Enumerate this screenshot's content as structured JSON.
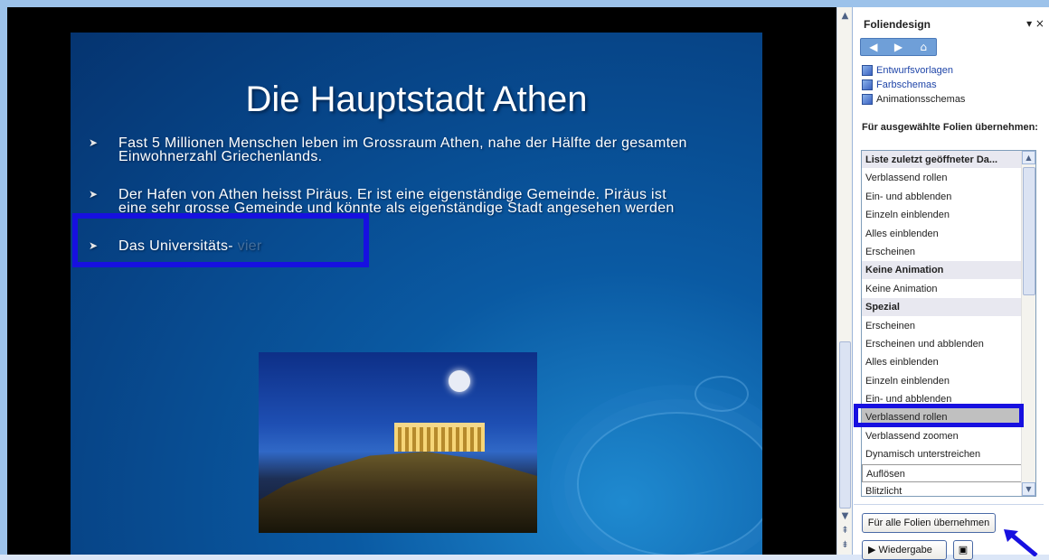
{
  "slide": {
    "title": "Die Hauptstadt Athen",
    "bullets": [
      {
        "lines": [
          "Fast 5 Millionen Menschen leben im Grossraum Athen, nahe der Hälfte der gesamten",
          "Einwohnerzahl Griechenlands."
        ]
      },
      {
        "lines": [
          "Der Hafen von Athen heisst Piräus. Er ist eine eigenständige Gemeinde. Piräus ist",
          "eine sehr grosse Gemeinde und könnte als eigenständige Stadt angesehen werden"
        ]
      },
      {
        "text": "Das Universitäts-",
        "faded_text": "vier"
      }
    ],
    "bullet_glyph": "➤"
  },
  "task_pane": {
    "title": "Foliendesign",
    "nav_icons": [
      "back-icon",
      "forward-icon",
      "home-icon"
    ],
    "nav_glyphs": [
      "◀",
      "▶",
      "⌂"
    ],
    "links": [
      {
        "label": "Entwurfsvorlagen",
        "icon": "template-icon"
      },
      {
        "label": "Farbschemas",
        "icon": "color-scheme-icon"
      },
      {
        "label": "Animationsschemas",
        "icon": "animation-scheme-icon"
      }
    ],
    "section_label": "Für ausgewählte Folien übernehmen:",
    "list": [
      {
        "label": "Liste zuletzt geöffneter Da...",
        "header": true
      },
      {
        "label": "Verblassend rollen"
      },
      {
        "label": "Ein- und abblenden"
      },
      {
        "label": "Einzeln einblenden"
      },
      {
        "label": "Alles einblenden"
      },
      {
        "label": "Erscheinen"
      },
      {
        "label": "Keine Animation",
        "header": true
      },
      {
        "label": "Keine Animation"
      },
      {
        "label": "Spezial",
        "header": true
      },
      {
        "label": "Erscheinen"
      },
      {
        "label": "Erscheinen und abblenden"
      },
      {
        "label": "Alles einblenden"
      },
      {
        "label": "Einzeln einblenden"
      },
      {
        "label": "Ein- und abblenden"
      },
      {
        "label": "Verblassend rollen",
        "selected": true
      },
      {
        "label": "Verblassend zoomen"
      },
      {
        "label": "Dynamisch unterstreichen"
      },
      {
        "label": "Auflösen",
        "boxed": true
      },
      {
        "label": "Blitzlicht"
      }
    ],
    "apply_all_button": "Für alle Folien übernehmen",
    "play_button": "Wiedergabe",
    "close_glyph": "▾ ×"
  },
  "colors": {
    "highlight": "#1710e0",
    "slide_blue": "#0a5aa3"
  }
}
